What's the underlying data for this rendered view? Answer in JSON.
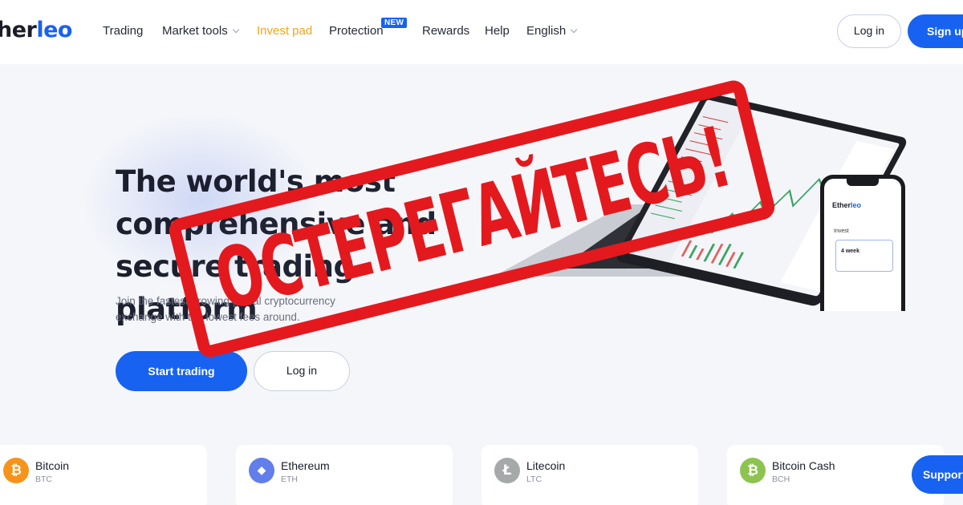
{
  "header": {
    "logo_prefix": "her",
    "logo_accent": "leo",
    "nav": [
      {
        "label": "Trading"
      },
      {
        "label": "Market tools"
      },
      {
        "label": "Invest pad"
      },
      {
        "label": "Protection"
      },
      {
        "label": "Rewards"
      },
      {
        "label": "Help"
      },
      {
        "label": "English"
      }
    ],
    "new_badge": "NEW",
    "login_label": "Log in",
    "signup_label": "Sign up"
  },
  "hero": {
    "title_line1": "The world's most",
    "title_line2": "comprehensive and",
    "title_line3": "secure trading platform",
    "subtitle_line1": "Join the fastest growing global cryptocurrency",
    "subtitle_line2": "exchange with the lowest fees around.",
    "start_label": "Start trading",
    "login_label": "Log in"
  },
  "phone": {
    "logo_prefix": "Ether",
    "logo_accent": "leo",
    "invest_label": "Invest",
    "card_text": "4 week"
  },
  "stamp": {
    "text": "ОСТЕРЕГАЙТЕСЬ!",
    "color": "#e3191e"
  },
  "coins": [
    {
      "name": "Bitcoin",
      "symbol": "BTC",
      "color": "#f7931a",
      "glyph": "₿"
    },
    {
      "name": "Ethereum",
      "symbol": "ETH",
      "color": "#627eea",
      "glyph": "◆"
    },
    {
      "name": "Litecoin",
      "symbol": "LTC",
      "color": "#a6a9aa",
      "glyph": "Ł"
    },
    {
      "name": "Bitcoin Cash",
      "symbol": "BCH",
      "color": "#8dc351",
      "glyph": "₿"
    }
  ],
  "support_label": "Support",
  "colors": {
    "brand_blue": "#1762f0",
    "accent_orange": "#f4a41b"
  }
}
